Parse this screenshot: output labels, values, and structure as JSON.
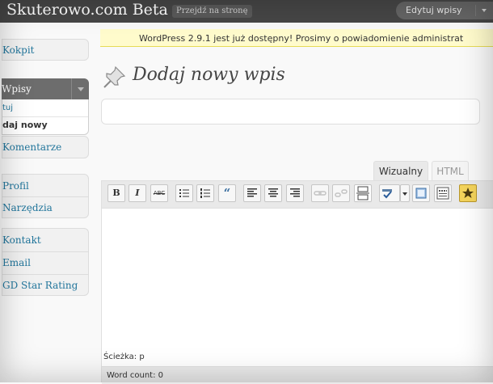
{
  "header": {
    "site_title": "Skuterowo.com Beta",
    "visit_site": "Przejdź na stronę",
    "favorites_label": "Edytuj wpisy"
  },
  "sidebar": {
    "kokpit": "Kokpit",
    "wpisy": "Wpisy",
    "wpisy_sub_edit": "tuj",
    "wpisy_sub_add": "daj nowy",
    "komentarze": "Komentarze",
    "profil": "Profil",
    "narzedzia": "Narzędzia",
    "kontakt": "Kontakt",
    "email": "Email",
    "gd_star": "GD Star Rating"
  },
  "notice": {
    "text": "WordPress 2.9.1 jest już dostępny! Prosimy o powiadomienie administrat"
  },
  "main": {
    "page_title": "Dodaj nowy wpis",
    "tab_visual": "Wizualny",
    "tab_html": "HTML",
    "path": "Ścieżka: p",
    "word_count": "Word count: 0"
  },
  "toolbar": {
    "bold": "B",
    "italic": "I",
    "strike": "ABC",
    "quote": "“"
  },
  "colors": {
    "link": "#21759b",
    "header_bg": "#464646",
    "notice_bg": "#fffbcc"
  }
}
